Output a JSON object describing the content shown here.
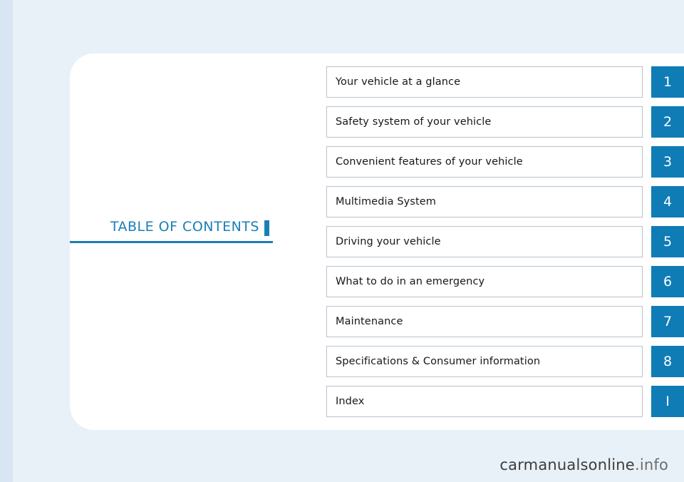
{
  "page": {
    "section_title": "TABLE OF CONTENTS",
    "watermark_main": "carmanualsonline",
    "watermark_suffix": ".info",
    "accent_color": "#0f7cb5",
    "background_color": "#e9f1f8"
  },
  "contents": [
    {
      "label": "Your vehicle at a glance",
      "number": "1"
    },
    {
      "label": "Safety system of your vehicle",
      "number": "2"
    },
    {
      "label": "Convenient features of your vehicle",
      "number": "3"
    },
    {
      "label": "Multimedia System",
      "number": "4"
    },
    {
      "label": "Driving your vehicle",
      "number": "5"
    },
    {
      "label": "What to do in an emergency",
      "number": "6"
    },
    {
      "label": "Maintenance",
      "number": "7"
    },
    {
      "label": "Specifications & Consumer information",
      "number": "8"
    },
    {
      "label": "Index",
      "number": "I"
    }
  ]
}
